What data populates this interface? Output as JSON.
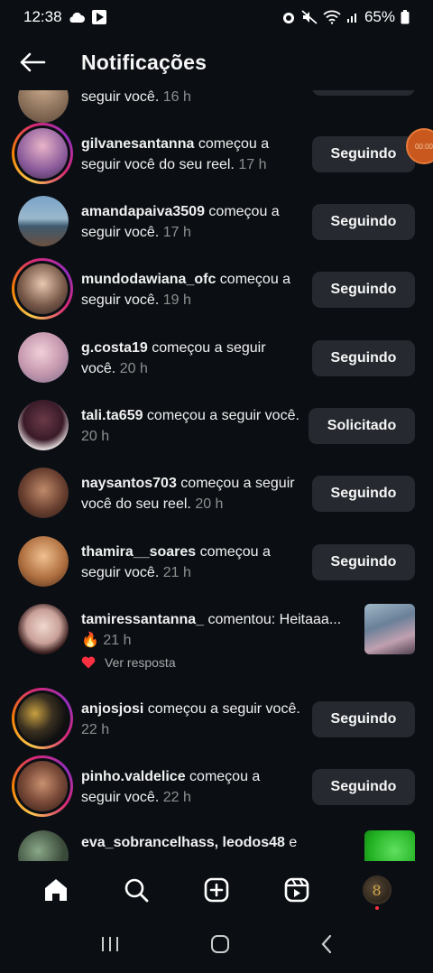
{
  "status_bar": {
    "time": "12:38",
    "battery": "65%"
  },
  "header": {
    "title": "Notificações"
  },
  "partial_top": {
    "text": "seguir você.",
    "time": "16 h"
  },
  "notifications": [
    {
      "user": "gilvanesantanna",
      "action": " começou a seguir você do seu reel.",
      "time": "17 h",
      "button": "Seguindo"
    },
    {
      "user": "amandapaiva3509",
      "action": " começou a seguir você.",
      "time": "17 h",
      "button": "Seguindo"
    },
    {
      "user": "mundodawiana_ofc",
      "action": " começou a seguir você.",
      "time": "19 h",
      "button": "Seguindo"
    },
    {
      "user": "g.costa19",
      "action": " começou a seguir você.",
      "time": "20 h",
      "button": "Seguindo"
    },
    {
      "user": "tali.ta659",
      "action": " começou a seguir você.",
      "time": "20 h",
      "button": "Solicitado"
    },
    {
      "user": "naysantos703",
      "action": " começou a seguir você do seu reel.",
      "time": "20 h",
      "button": "Seguindo"
    },
    {
      "user": "thamira__soares",
      "action": " começou a seguir você.",
      "time": "21 h",
      "button": "Seguindo"
    },
    {
      "user": "tamiressantanna_",
      "action": " comentou: Heitaaa... 🔥",
      "time": "21 h",
      "reply": "Ver resposta"
    },
    {
      "user": "anjosjosi",
      "action": " começou a seguir você.",
      "time": "22 h",
      "button": "Seguindo"
    },
    {
      "user": "pinho.valdelice",
      "action": " começou a seguir você.",
      "time": "22 h",
      "button": "Seguindo"
    },
    {
      "user": "eva_sobrancelhass, leodos48",
      "action": " e"
    }
  ],
  "nav": {
    "home": "home-icon",
    "search": "search-icon",
    "create": "plus-square-icon",
    "reels": "reels-icon",
    "profile_letter": "8"
  },
  "colors": {
    "background": "#0b0f14",
    "button": "#262a30",
    "accent": "#ff3040"
  }
}
